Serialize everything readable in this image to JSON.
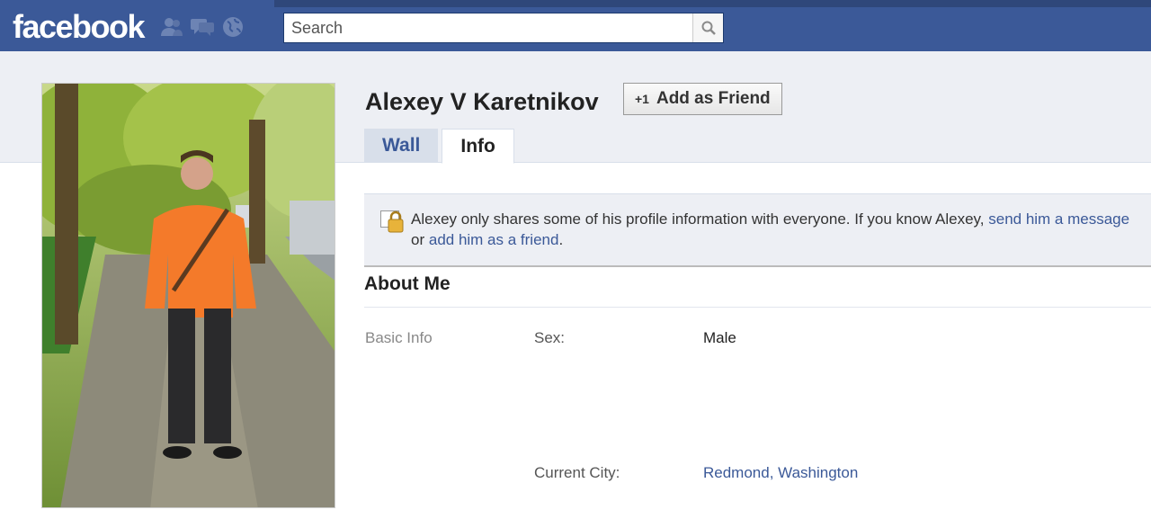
{
  "brand": {
    "logo_text": "facebook"
  },
  "topbar": {
    "jewels": [
      "friends-icon",
      "messages-icon",
      "globe-icon"
    ],
    "search": {
      "placeholder": "Search",
      "value": ""
    }
  },
  "profile": {
    "name": "Alexey V Karetnikov",
    "add_friend_label": "Add as Friend",
    "add_friend_icon": "+1",
    "photo_alt": "profile-photo"
  },
  "tabs": [
    {
      "label": "Wall",
      "active": false
    },
    {
      "label": "Info",
      "active": true
    }
  ],
  "notice": {
    "text_before": "Alexey only shares some of his profile information with everyone. If you know Alexey,",
    "link_message": "send him a message",
    "text_middle": "or",
    "link_friend": "add him as a friend",
    "text_after": "."
  },
  "about": {
    "title": "About Me",
    "section_label": "Basic Info",
    "rows": [
      {
        "label": "Sex:",
        "value": "Male"
      },
      {
        "label": "Current City:",
        "value": "Redmond, Washington"
      }
    ]
  },
  "colors": {
    "brand_blue": "#3b5998",
    "band_gray": "#edeff4",
    "tab_blue": "#d8dfea"
  }
}
